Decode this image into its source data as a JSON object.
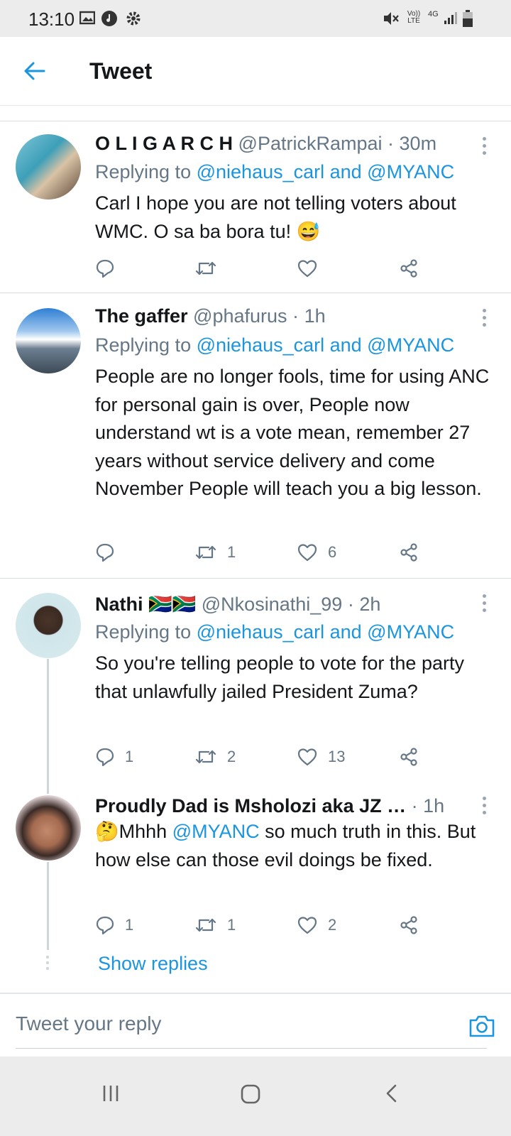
{
  "status_bar": {
    "time": "13:10",
    "volte": "Vo)) LTE",
    "network": "4G"
  },
  "header": {
    "title": "Tweet"
  },
  "tweets": [
    {
      "name": "O L I G A R C H",
      "handle": "@PatrickRampai",
      "sep": "·",
      "age": "30m",
      "replying_prefix": "Replying to",
      "replying_links": "@niehaus_carl and @MYANC",
      "text": "Carl I hope you are not telling voters about WMC. O sa ba bora tu! 😅",
      "replies": "",
      "retweets": "",
      "likes": ""
    },
    {
      "name": "The gaffer",
      "handle": "@phafurus",
      "sep": "·",
      "age": "1h",
      "replying_prefix": "Replying to",
      "replying_links": "@niehaus_carl and @MYANC",
      "text": "People are no longer  fools, time for using ANC for personal gain is over, People now understand wt is a vote mean, remember 27 years without service delivery and come November People will teach you a big lesson.",
      "replies": "",
      "retweets": "1",
      "likes": "6"
    },
    {
      "name": "Nathi 🇿🇦🇿🇦",
      "handle": "@Nkosinathi_99",
      "sep": "·",
      "age": "2h",
      "replying_prefix": "Replying to",
      "replying_links": "@niehaus_carl and @MYANC",
      "text": "So you're telling people to vote for the party that unlawfully jailed President Zuma?",
      "replies": "1",
      "retweets": "2",
      "likes": "13"
    },
    {
      "name": "Proudly Dad is Msholozi aka JZ …",
      "handle": "",
      "sep": "·",
      "age": "1h",
      "text_prefix": "🤔Mhhh ",
      "text_mention": "@MYANC",
      "text_rest": "  so much truth in this. But how else can those evil doings be fixed.",
      "replies": "1",
      "retweets": "1",
      "likes": "2"
    }
  ],
  "show_replies": "Show replies",
  "reply_input": {
    "placeholder": "Tweet your reply"
  },
  "colors": {
    "accent": "#1b95e0",
    "secondary_text": "#657786",
    "primary_text": "#14171a"
  }
}
